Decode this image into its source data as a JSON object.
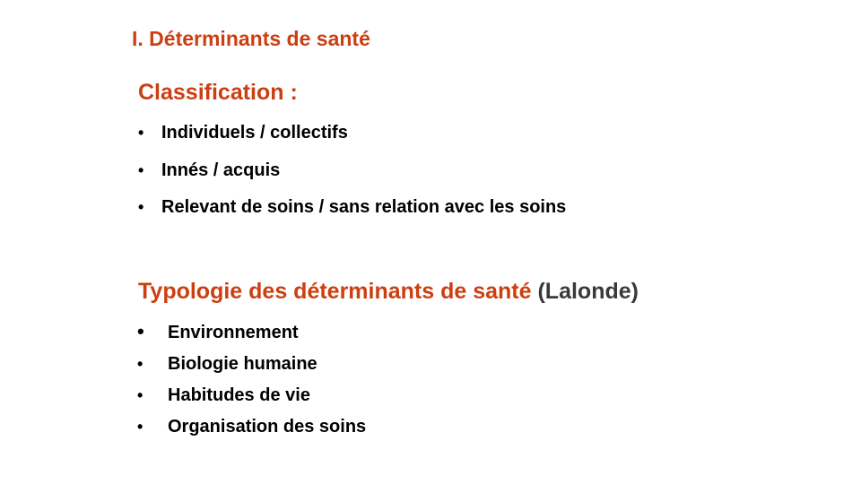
{
  "slide": {
    "title": "I. Déterminants de santé",
    "bullet_glyph": "•",
    "colors": {
      "accent": "#cc3f10",
      "text": "#000000",
      "muted": "#3a3a3a",
      "background": "#ffffff"
    }
  },
  "classification": {
    "heading": "Classification :",
    "items": [
      "Individuels / collectifs",
      "Innés / acquis",
      "Relevant de soins / sans relation avec les soins"
    ]
  },
  "typology": {
    "heading": "Typologie des déterminants de santé",
    "heading_suffix": "(Lalonde)",
    "items": [
      "Environnement",
      "Biologie humaine",
      "Habitudes de vie",
      "Organisation des soins"
    ]
  }
}
